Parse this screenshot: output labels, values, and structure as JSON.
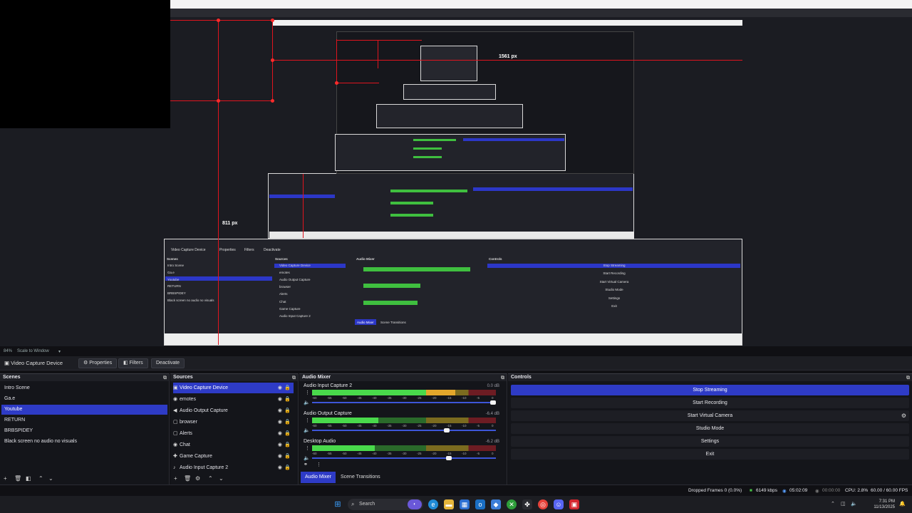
{
  "preview": {
    "label_1561": "1561 px",
    "label_811": "811 px",
    "nested": {
      "source_name": "Video Capture Device",
      "properties": "Properties",
      "filters": "Filters",
      "deactivate": "Deactivate",
      "scenes_title": "Scenes",
      "sources_title": "Sources",
      "mixer_title": "Audio Mixer",
      "controls_title": "Controls",
      "scene_items": [
        "Intro Scene",
        "Ga.e",
        "Youtube",
        "RETURN",
        "BRBSPIDEY",
        "Black screen no audio no visuals"
      ],
      "source_items": [
        "Video Capture Device",
        "emotes",
        "Audio Output Capture",
        "browser",
        "Alerts",
        "Chat",
        "Game Capture",
        "Audio Input Capture 2"
      ],
      "control_items": [
        "Stop Streaming",
        "Start Recording",
        "Start Virtual Camera",
        "Studio Mode",
        "Settings",
        "Exit"
      ],
      "mixer_tab": "Audio Mixer",
      "transitions_tab": "Scene Transitions"
    }
  },
  "scale": {
    "zoom": "84%",
    "scale_label": "Scale to Window"
  },
  "context_bar": {
    "source_name": "Video Capture Device",
    "properties": "Properties",
    "filters": "Filters",
    "deactivate": "Deactivate"
  },
  "scenes": {
    "title": "Scenes",
    "items": [
      {
        "label": "Intro Scene"
      },
      {
        "label": "Ga.e"
      },
      {
        "label": "Youtube"
      },
      {
        "label": "RETURN"
      },
      {
        "label": "BRBSPIDEY"
      },
      {
        "label": "Black screen no audio no visuals"
      }
    ],
    "selected": "Youtube"
  },
  "sources": {
    "title": "Sources",
    "items": [
      {
        "label": "Video Capture Device",
        "icon": "monitor-icon"
      },
      {
        "label": "emotes",
        "icon": "globe-icon"
      },
      {
        "label": "Audio Output Capture",
        "icon": "speaker-icon"
      },
      {
        "label": "browser",
        "icon": "window-icon"
      },
      {
        "label": "Alerts",
        "icon": "window-icon"
      },
      {
        "label": "Chat",
        "icon": "globe-icon"
      },
      {
        "label": "Game Capture",
        "icon": "gamepad-icon"
      },
      {
        "label": "Audio Input Capture 2",
        "icon": "microphone-icon"
      }
    ]
  },
  "mixer": {
    "title": "Audio Mixer",
    "channels": [
      {
        "name": "Audio Input Capture 2",
        "db": "0.0 dB",
        "level": 0.78,
        "volume": 1.0
      },
      {
        "name": "Audio Output Capture",
        "db": "-6.4 dB",
        "level": 0.36,
        "volume": 0.74
      },
      {
        "name": "Desktop Audio",
        "db": "-6.2 dB",
        "level": 0.34,
        "volume": 0.75
      }
    ],
    "scale_ticks": [
      "-60",
      "-55",
      "-50",
      "-45",
      "-40",
      "-35",
      "-30",
      "-25",
      "-20",
      "-15",
      "-10",
      "-5",
      "0"
    ],
    "tab_mixer": "Audio Mixer",
    "tab_transitions": "Scene Transitions"
  },
  "controls": {
    "title": "Controls",
    "buttons": [
      "Stop Streaming",
      "Start Recording",
      "Start Virtual Camera",
      "Studio Mode",
      "Settings",
      "Exit"
    ]
  },
  "status": {
    "dropped": "Dropped Frames 0 (0.0%)",
    "bitrate": "6149 kbps",
    "stream_time": "05:02:09",
    "record_time": "00:00:00",
    "cpu": "CPU: 2.8%",
    "fps": "60.00 / 60.00 FPS"
  },
  "taskbar": {
    "search_placeholder": "Search",
    "time": "7:31 PM",
    "date": "11/13/2025"
  }
}
